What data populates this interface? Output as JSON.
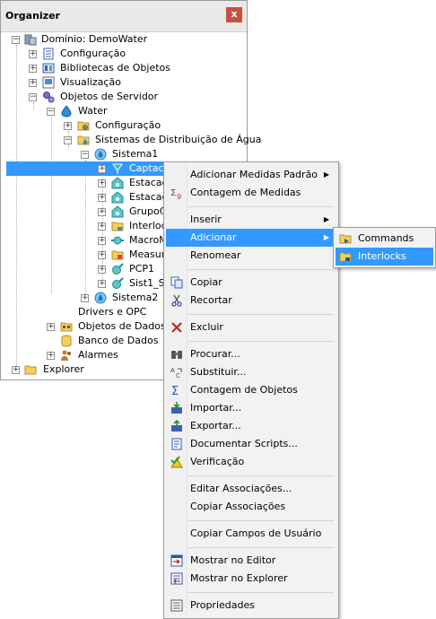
{
  "organizer": {
    "title": "Organizer",
    "close_label": "x"
  },
  "tree": {
    "items": [
      {
        "label": "Domínio: DemoWater",
        "icon": "domain-icon",
        "expander": "−"
      },
      {
        "label": "Configuração",
        "icon": "config-icon",
        "expander": "+"
      },
      {
        "label": "Bibliotecas de Objetos",
        "icon": "library-icon",
        "expander": "+"
      },
      {
        "label": "Visualização",
        "icon": "display-icon",
        "expander": "+"
      },
      {
        "label": "Objetos de Servidor",
        "icon": "gears-icon",
        "expander": "−"
      },
      {
        "label": "Water",
        "icon": "water-drop-icon",
        "expander": "−"
      },
      {
        "label": "Configuração",
        "icon": "folder-gear-icon",
        "expander": "+"
      },
      {
        "label": "Sistemas de Distribuição de Água",
        "icon": "folder-water-icon",
        "expander": "−"
      },
      {
        "label": "Sistema1",
        "icon": "water-system-icon",
        "expander": "−"
      },
      {
        "label": "Captaca",
        "icon": "intake-icon",
        "expander": "+"
      },
      {
        "label": "Estacao",
        "icon": "station-icon",
        "expander": "+"
      },
      {
        "label": "Estacao",
        "icon": "station-icon",
        "expander": "+"
      },
      {
        "label": "GrupoCo",
        "icon": "station-icon",
        "expander": "+"
      },
      {
        "label": "Interlock",
        "icon": "folder-lock-icon",
        "expander": "+"
      },
      {
        "label": "MacroMe",
        "icon": "meter-icon",
        "expander": "+"
      },
      {
        "label": "Measure",
        "icon": "folder-measure-icon",
        "expander": "+"
      },
      {
        "label": "PCP1",
        "icon": "pump-icon",
        "expander": "+"
      },
      {
        "label": "Sist1_Sis",
        "icon": "pump-icon",
        "expander": "+"
      },
      {
        "label": "Sistema2",
        "icon": "water-system-icon",
        "expander": "+"
      },
      {
        "label": "Drivers e OPC",
        "icon": "",
        "expander": ""
      },
      {
        "label": "Objetos de Dados",
        "icon": "data-objects-icon",
        "expander": "+"
      },
      {
        "label": "Banco de Dados",
        "icon": "database-icon",
        "expander": ""
      },
      {
        "label": "Alarmes",
        "icon": "alarm-icon",
        "expander": "+"
      },
      {
        "label": "Explorer",
        "icon": "folder-icon",
        "expander": "+"
      }
    ]
  },
  "context_menu": {
    "items": [
      {
        "label": "Adicionar Medidas Padrão",
        "icon": "",
        "submenu": true
      },
      {
        "label": "Contagem de Medidas",
        "icon": "sigma-count-icon"
      },
      {
        "label": "Inserir",
        "icon": "",
        "submenu": true
      },
      {
        "label": "Adicionar",
        "icon": "",
        "submenu": true
      },
      {
        "label": "Renomear",
        "icon": ""
      },
      {
        "label": "Copiar",
        "icon": "copy-icon"
      },
      {
        "label": "Recortar",
        "icon": "cut-icon"
      },
      {
        "label": "Excluir",
        "icon": "delete-icon"
      },
      {
        "label": "Procurar...",
        "icon": "binoculars-icon"
      },
      {
        "label": "Substituir...",
        "icon": "replace-icon"
      },
      {
        "label": "Contagem de Objetos",
        "icon": "sigma-icon"
      },
      {
        "label": "Importar...",
        "icon": "import-icon"
      },
      {
        "label": "Exportar...",
        "icon": "export-icon"
      },
      {
        "label": "Documentar Scripts...",
        "icon": "document-scripts-icon"
      },
      {
        "label": "Verificação",
        "icon": "check-warning-icon"
      },
      {
        "label": "Editar Associações...",
        "icon": ""
      },
      {
        "label": "Copiar Associações",
        "icon": ""
      },
      {
        "label": "Copiar Campos de Usuário",
        "icon": ""
      },
      {
        "label": "Mostrar no Editor",
        "icon": "show-editor-icon"
      },
      {
        "label": "Mostrar no Explorer",
        "icon": "show-explorer-icon"
      },
      {
        "label": "Propriedades",
        "icon": "properties-icon"
      }
    ],
    "submenu_arrow": "▶"
  },
  "submenu": {
    "items": [
      {
        "label": "Commands",
        "icon": "folder-commands-icon"
      },
      {
        "label": "Interlocks",
        "icon": "folder-interlocks-icon"
      }
    ]
  },
  "colors": {
    "selection": "#3399ff",
    "close_button": "#c9503e",
    "menu_background": "#f2f2f2"
  }
}
